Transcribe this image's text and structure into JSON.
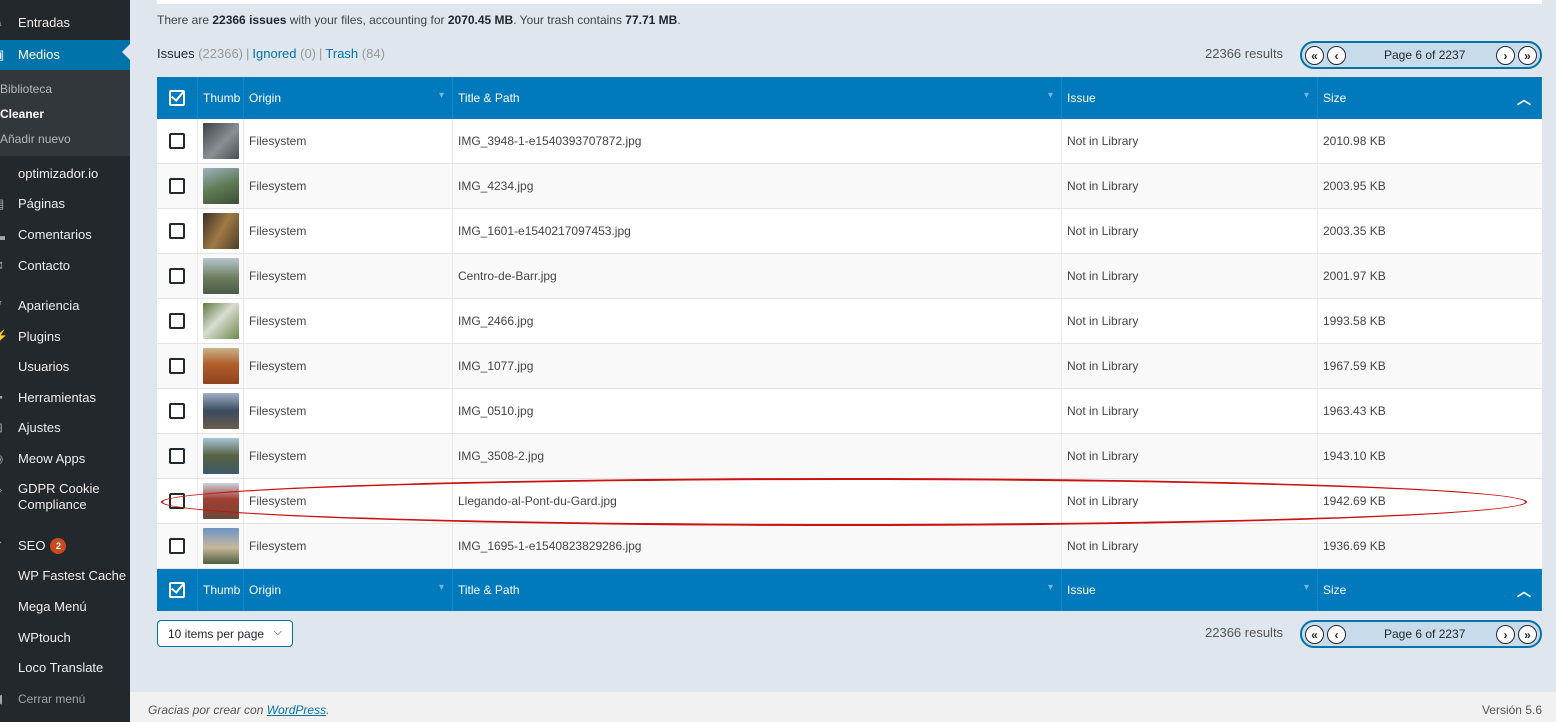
{
  "sidebar": {
    "items": [
      {
        "label": "Entradas",
        "icon": "pin-icon"
      },
      {
        "label": "Medios",
        "icon": "media-icon"
      },
      {
        "label": "optimizador.io",
        "icon": "gauge-icon"
      },
      {
        "label": "Páginas",
        "icon": "page-icon"
      },
      {
        "label": "Comentarios",
        "icon": "comment-icon"
      },
      {
        "label": "Contacto",
        "icon": "mail-icon"
      },
      {
        "label": "Apariencia",
        "icon": "brush-icon"
      },
      {
        "label": "Plugins",
        "icon": "plugin-icon"
      },
      {
        "label": "Usuarios",
        "icon": "user-icon"
      },
      {
        "label": "Herramientas",
        "icon": "wrench-icon"
      },
      {
        "label": "Ajustes",
        "icon": "settings-icon"
      },
      {
        "label": "Meow Apps",
        "icon": "meow-icon"
      },
      {
        "label": "GDPR Cookie",
        "label2": "Compliance",
        "icon": "shield-icon"
      },
      {
        "label": "SEO",
        "icon": "seo-icon",
        "badge": "2"
      },
      {
        "label": "WP Fastest Cache",
        "icon": "cache-icon"
      },
      {
        "label": "Mega Menú",
        "icon": "menu-icon"
      },
      {
        "label": "WPtouch",
        "icon": "touch-icon"
      },
      {
        "label": "Loco Translate",
        "icon": "translate-icon"
      },
      {
        "label": "Cerrar menú",
        "icon": "collapse-icon"
      }
    ],
    "submenu": [
      "Biblioteca",
      "Cleaner",
      "Añadir nuevo"
    ]
  },
  "summary": {
    "p1": "There are ",
    "issues": "22366 issues",
    "p2": " with your files, accounting for ",
    "size": "2070.45 MB",
    "p3": ". Your trash contains ",
    "trash": "77.71 MB",
    "p4": "."
  },
  "tabs": {
    "issues_label": "Issues",
    "issues_count": "(22366)",
    "ignored_label": "Ignored",
    "ignored_count": "(0)",
    "trash_label": "Trash",
    "trash_count": "(84)",
    "sep": "|"
  },
  "results_label": "22366 results",
  "pager_text": "Page 6 of 2237",
  "columns": {
    "thumb": "Thumb",
    "origin": "Origin",
    "title": "Title & Path",
    "issue": "Issue",
    "size": "Size"
  },
  "rows": [
    {
      "origin": "Filesystem",
      "path": "IMG_3948-1-e1540393707872.jpg",
      "issue": "Not in Library",
      "size": "2010.98 KB",
      "thumb_color": "#6b6f73"
    },
    {
      "origin": "Filesystem",
      "path": "IMG_4234.jpg",
      "issue": "Not in Library",
      "size": "2003.95 KB",
      "thumb_color": "#6f8a6a"
    },
    {
      "origin": "Filesystem",
      "path": "IMG_1601-e1540217097453.jpg",
      "issue": "Not in Library",
      "size": "2003.35 KB",
      "thumb_color": "#8a6f4c"
    },
    {
      "origin": "Filesystem",
      "path": "Centro-de-Barr.jpg",
      "issue": "Not in Library",
      "size": "2001.97 KB",
      "thumb_color": "#7c8f7a"
    },
    {
      "origin": "Filesystem",
      "path": "IMG_2466.jpg",
      "issue": "Not in Library",
      "size": "1993.58 KB",
      "thumb_color": "#7f9a6c"
    },
    {
      "origin": "Filesystem",
      "path": "IMG_1077.jpg",
      "issue": "Not in Library",
      "size": "1967.59 KB",
      "thumb_color": "#b4683a"
    },
    {
      "origin": "Filesystem",
      "path": "IMG_0510.jpg",
      "issue": "Not in Library",
      "size": "1963.43 KB",
      "thumb_color": "#65758a"
    },
    {
      "origin": "Filesystem",
      "path": "IMG_3508-2.jpg",
      "issue": "Not in Library",
      "size": "1943.10 KB",
      "thumb_color": "#7e8b8f"
    },
    {
      "origin": "Filesystem",
      "path": "Llegando-al-Pont-du-Gard.jpg",
      "issue": "Not in Library",
      "size": "1942.69 KB",
      "thumb_color": "#a34a3a"
    },
    {
      "origin": "Filesystem",
      "path": "IMG_1695-1-e1540823829286.jpg",
      "issue": "Not in Library",
      "size": "1936.69 KB",
      "thumb_color": "#6d87a6"
    }
  ],
  "perpage_label": "10 items per page",
  "footer": {
    "left_text": "Gracias por crear con ",
    "left_link": "WordPress",
    "left_end": ".",
    "version": "Versión 5.6"
  },
  "colors": {
    "accent": "#0073aa",
    "header_blue": "#0079bd",
    "highlight": "#cc1111"
  }
}
